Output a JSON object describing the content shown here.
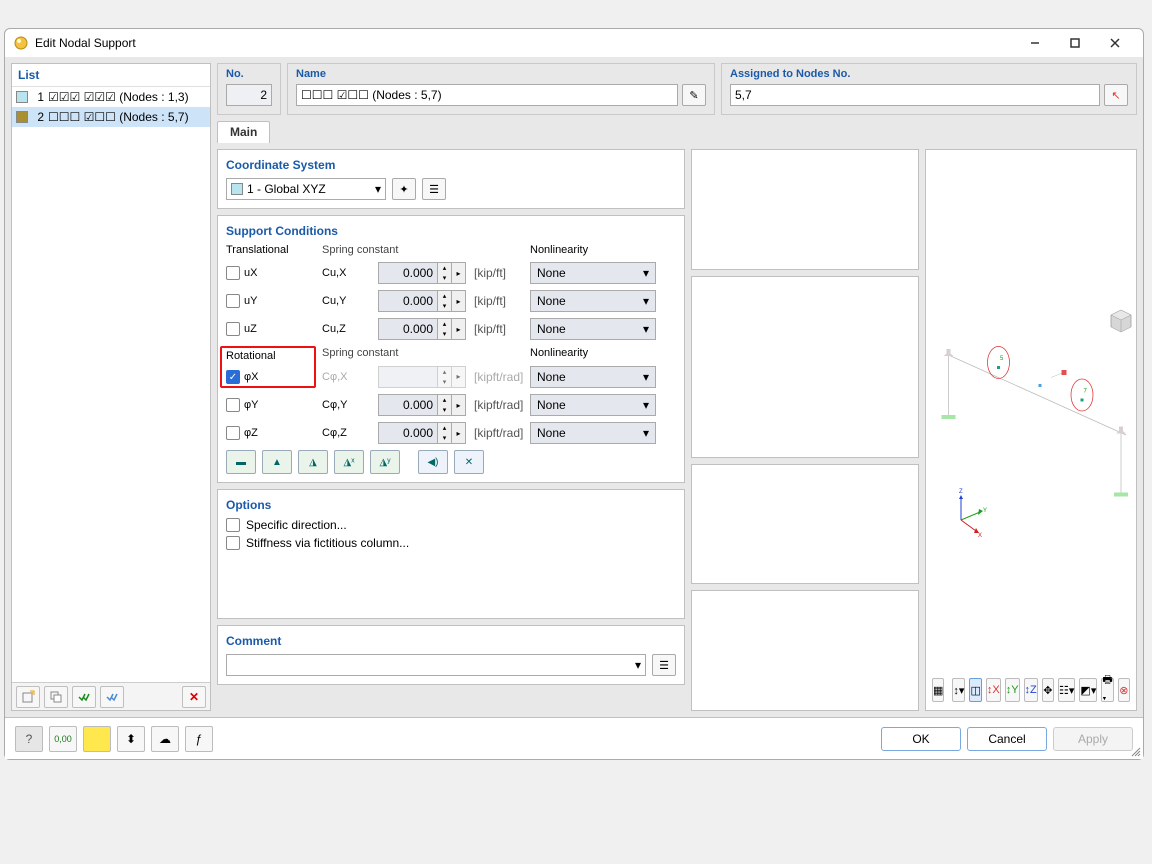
{
  "window": {
    "title": "Edit Nodal Support"
  },
  "list": {
    "header": "List",
    "items": [
      {
        "num": "1",
        "color": "#b8e4f0",
        "label": "☑☑☑ ☑☑☑ (Nodes : 1,3)"
      },
      {
        "num": "2",
        "color": "#a89030",
        "label": "☐☐☐ ☑☐☐ (Nodes : 5,7)"
      }
    ]
  },
  "header": {
    "no_label": "No.",
    "no_value": "2",
    "name_label": "Name",
    "name_value": "☐☐☐ ☑☐☐ (Nodes : 5,7)",
    "assigned_label": "Assigned to Nodes No.",
    "assigned_value": "5,7"
  },
  "tabs": {
    "main": "Main"
  },
  "coord": {
    "title": "Coordinate System",
    "combo": "1 - Global XYZ"
  },
  "support": {
    "title": "Support Conditions",
    "trans_hdr": "Translational",
    "spring_hdr": "Spring constant",
    "nonlin_hdr": "Nonlinearity",
    "rot_hdr": "Rotational",
    "ux": "uX",
    "uy": "uY",
    "uz": "uZ",
    "phix": "φX",
    "phiy": "φY",
    "phiz": "φZ",
    "cux": "Cu,X",
    "cuy": "Cu,Y",
    "cuz": "Cu,Z",
    "cphix": "Cφ,X",
    "cphiy": "Cφ,Y",
    "cphiz": "Cφ,Z",
    "val": "0.000",
    "val_blank": "",
    "unit_t": "[kip/ft]",
    "unit_r": "[kipft/rad]",
    "none": "None"
  },
  "options": {
    "title": "Options",
    "specific": "Specific direction...",
    "stiffness": "Stiffness via fictitious column..."
  },
  "comment": {
    "title": "Comment"
  },
  "preview": {
    "node5": "5",
    "node7": "7",
    "ax_x": "X",
    "ax_y": "Y",
    "ax_z": "Z"
  },
  "footer": {
    "ok": "OK",
    "cancel": "Cancel",
    "apply": "Apply"
  }
}
